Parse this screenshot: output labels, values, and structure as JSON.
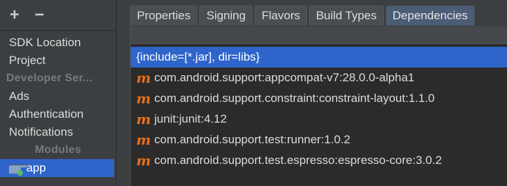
{
  "toolbar": {
    "add_label": "+",
    "remove_label": "−"
  },
  "sidebar": {
    "items": [
      {
        "label": "SDK Location",
        "type": "item"
      },
      {
        "label": "Project",
        "type": "item"
      },
      {
        "label": "Developer Ser...",
        "type": "header"
      },
      {
        "label": "Ads",
        "type": "item"
      },
      {
        "label": "Authentication",
        "type": "item"
      },
      {
        "label": "Notifications",
        "type": "item"
      },
      {
        "label": "Modules",
        "type": "header"
      },
      {
        "label": "app",
        "type": "item",
        "selected": true,
        "icon": "module-folder-icon"
      }
    ]
  },
  "tabs": [
    {
      "label": "Properties"
    },
    {
      "label": "Signing"
    },
    {
      "label": "Flavors"
    },
    {
      "label": "Build Types"
    },
    {
      "label": "Dependencies",
      "active": true
    }
  ],
  "dependencies": [
    {
      "label": "{include=[*.jar], dir=libs}",
      "icon": "none",
      "selected": true
    },
    {
      "label": "com.android.support:appcompat-v7:28.0.0-alpha1",
      "icon": "maven-icon"
    },
    {
      "label": "com.android.support.constraint:constraint-layout:1.1.0",
      "icon": "maven-icon"
    },
    {
      "label": "junit:junit:4.12",
      "icon": "maven-icon"
    },
    {
      "label": "com.android.support.test:runner:1.0.2",
      "icon": "maven-icon"
    },
    {
      "label": "com.android.support.test.espresso:espresso-core:3.0.2",
      "icon": "maven-icon"
    }
  ],
  "icons": {
    "maven_glyph": "m"
  },
  "colors": {
    "selection": "#2f65ca",
    "maven_icon": "#e8701a",
    "active_tab": "#4a5c76"
  }
}
